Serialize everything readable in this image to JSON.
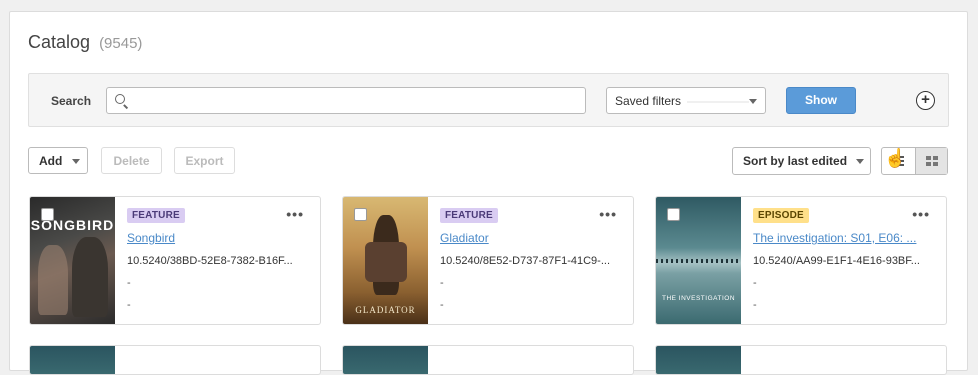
{
  "catalog": {
    "title": "Catalog",
    "count": "(9545)"
  },
  "search": {
    "label": "Search",
    "placeholder": "",
    "value": ""
  },
  "saved_filters": {
    "label": "Saved filters"
  },
  "show_button": {
    "label": "Show"
  },
  "toolbar": {
    "add_label": "Add",
    "delete_label": "Delete",
    "export_label": "Export",
    "sort_label": "Sort by last edited"
  },
  "cards": [
    {
      "type": "FEATURE",
      "title": "Songbird",
      "doi": "10.5240/38BD-52E8-7382-B16F...",
      "field1": "-",
      "field2": "-",
      "poster_text": "SONGBIRD"
    },
    {
      "type": "FEATURE",
      "title": "Gladiator",
      "doi": "10.5240/8E52-D737-87F1-41C9-...",
      "field1": "-",
      "field2": "-",
      "poster_text": "GLADIATOR"
    },
    {
      "type": "EPISODE",
      "title": "The investigation: S01, E06: ...",
      "doi": "10.5240/AA99-E1F1-4E16-93BF...",
      "field1": "-",
      "field2": "-",
      "poster_text": "THE INVESTIGATION"
    }
  ],
  "colors": {
    "accent": "#5b9bd9",
    "link": "#4a89c8",
    "feature_badge": "#d9ccf2",
    "episode_badge": "#ffe08a"
  },
  "icons": {
    "search": "search-icon",
    "add": "plus-circle-icon",
    "more": "more-dots-icon",
    "list_view": "list-view-icon",
    "grid_view": "grid-view-icon"
  }
}
